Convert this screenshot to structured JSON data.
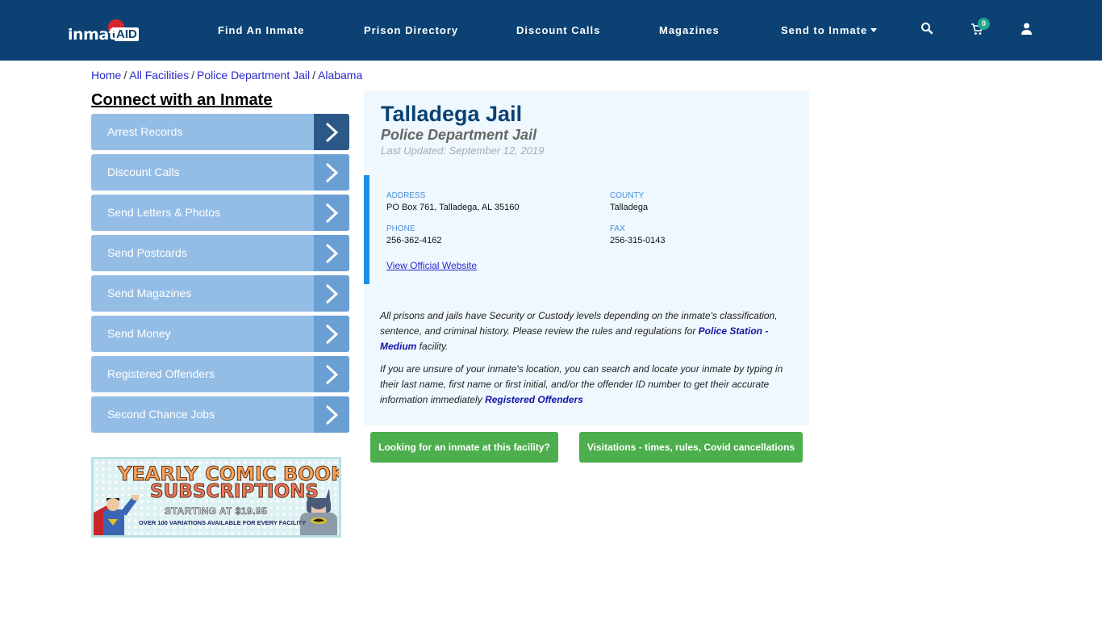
{
  "navbar": {
    "logo_text": "inmate",
    "logo_aid": "AID",
    "items": [
      {
        "label": "Find An Inmate"
      },
      {
        "label": "Prison Directory"
      },
      {
        "label": "Discount Calls"
      },
      {
        "label": "Magazines"
      },
      {
        "label": "Send to Inmate",
        "has_dropdown": true
      }
    ],
    "cart_count": "0",
    "icons": [
      "search-icon",
      "cart-icon",
      "user-icon"
    ],
    "bg_color": "#0b4273"
  },
  "breadcrumb": [
    {
      "label": "Home"
    },
    {
      "label": "All Facilities"
    },
    {
      "label": "Police Department Jail"
    },
    {
      "label": "Alabama"
    }
  ],
  "sidebar": {
    "title": "Connect with an Inmate",
    "items": [
      {
        "label": "Arrest Records"
      },
      {
        "label": "Discount Calls"
      },
      {
        "label": "Send Letters & Photos"
      },
      {
        "label": "Send Postcards"
      },
      {
        "label": "Send Magazines"
      },
      {
        "label": "Send Money"
      },
      {
        "label": "Registered Offenders"
      },
      {
        "label": "Second Chance Jobs"
      }
    ],
    "ad": {
      "line1": "YEARLY COMIC BOOK",
      "line2": "SUBSCRIPTIONS",
      "line3": "STARTING AT $19.95",
      "line4": "OVER 100 VARIATIONS AVAILABLE FOR EVERY FACILITY"
    }
  },
  "facility": {
    "name": "Talladega Jail",
    "type": "Police Department Jail",
    "last_updated": "Last Updated: September 12, 2019",
    "address_label": "ADDRESS",
    "address": "PO Box 761, Talladega, AL 35160",
    "county_label": "COUNTY",
    "county": "Talladega",
    "phone_label": "PHONE",
    "phone": "256-362-4162",
    "fax_label": "FAX",
    "fax": "256-315-0143",
    "website_link": "View Official Website",
    "para1_text": "All prisons and jails have Security or Custody levels depending on the inmate's classification, sentence, and criminal history. Please review the rules and regulations for ",
    "para1_link": "Police Station - Medium",
    "para1_end": " facility.",
    "para2_text": "If you are unsure of your inmate's location, you can search and locate your inmate by typing in their last name, first name or first initial, and/or the offender ID number to get their accurate information immediately ",
    "para2_link": "Registered Offenders"
  },
  "buttons": {
    "find_inmate": "Looking for an inmate at this facility?",
    "visitations": "Visitations - times, rules, Covid cancellations"
  }
}
